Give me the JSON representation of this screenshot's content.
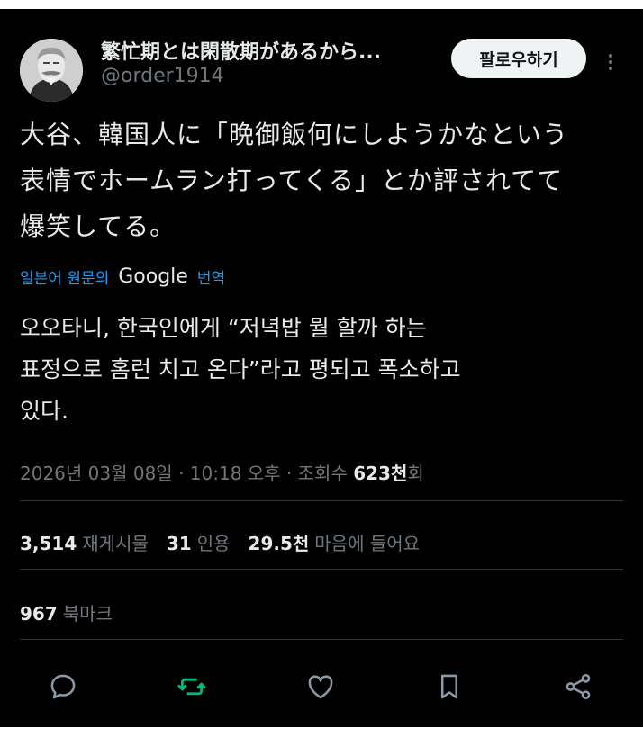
{
  "author": {
    "display_name": "繁忙期とは閑散期があるから...",
    "handle": "@order1914",
    "follow_label": "팔로우하기"
  },
  "tweet": {
    "original_lines": [
      "大谷、韓国人に「晩御飯何にしようかなという",
      "表情でホームラン打ってくる」とか評されてて",
      "爆笑してる。"
    ],
    "translation_prefix": "일본어 원문의",
    "translation_provider": "Google",
    "translation_suffix": "번역",
    "translated_lines": [
      "오오타니, 한국인에게 “저녁밥 뭘 할까 하는",
      "표정으로 홈런 치고 온다”라고 평되고 폭소하고",
      "있다."
    ]
  },
  "meta": {
    "timestamp": "2026년 03월 08일 · 10:18 오후 · 조회수 ",
    "views": "623천",
    "views_suffix": "회"
  },
  "stats": {
    "reposts_count": "3,514",
    "reposts_label": "재게시물",
    "quotes_count": "31",
    "quotes_label": "인용",
    "likes_count": "29.5천",
    "likes_label": "마음에 들어요",
    "bookmarks_count": "967",
    "bookmarks_label": "북마크"
  },
  "actions": {
    "reply_icon": "reply-icon",
    "repost_icon": "repost-icon",
    "repost_color": "#00ba7c",
    "like_icon": "heart-icon",
    "bookmark_icon": "bookmark-icon",
    "share_icon": "share-icon"
  }
}
